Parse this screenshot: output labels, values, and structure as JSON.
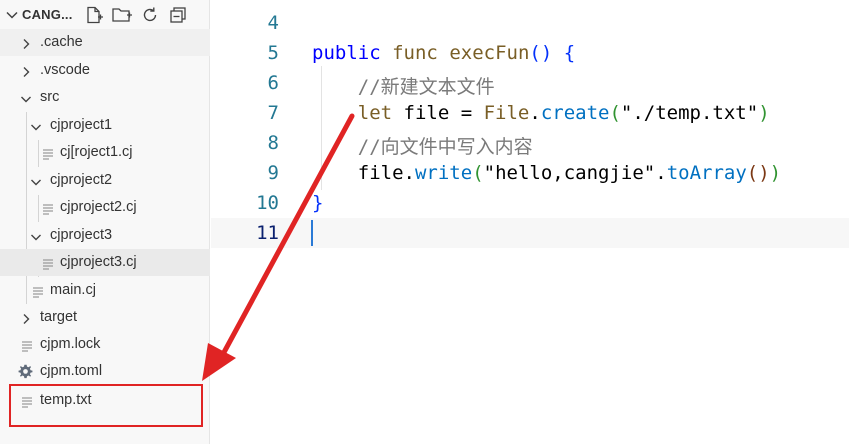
{
  "explorer": {
    "title": "CANG...",
    "actions": [
      "new-file-icon",
      "new-folder-icon",
      "refresh-icon",
      "collapse-all-icon"
    ],
    "items": [
      {
        "label": ".cache",
        "type": "folder",
        "expanded": false
      },
      {
        "label": ".vscode",
        "type": "folder",
        "expanded": false
      },
      {
        "label": "src",
        "type": "folder",
        "expanded": true
      },
      {
        "label": "cjproject1",
        "type": "folder",
        "expanded": true
      },
      {
        "label": "cj[roject1.cj",
        "type": "file"
      },
      {
        "label": "cjproject2",
        "type": "folder",
        "expanded": true
      },
      {
        "label": "cjproject2.cj",
        "type": "file"
      },
      {
        "label": "cjproject3",
        "type": "folder",
        "expanded": true
      },
      {
        "label": "cjproject3.cj",
        "type": "file",
        "selected": true
      },
      {
        "label": "main.cj",
        "type": "file"
      },
      {
        "label": "target",
        "type": "folder",
        "expanded": false
      },
      {
        "label": "cjpm.lock",
        "type": "file"
      },
      {
        "label": "cjpm.toml",
        "type": "settings-file"
      },
      {
        "label": "temp.txt",
        "type": "file",
        "highlighted": true
      }
    ]
  },
  "editor": {
    "lines": [
      {
        "number": "4",
        "tokens": []
      },
      {
        "number": "5",
        "tokens": [
          {
            "t": "public",
            "c": "kw2"
          },
          {
            "t": " "
          },
          {
            "t": "func",
            "c": "kw"
          },
          {
            "t": " "
          },
          {
            "t": "execFun",
            "c": "fn"
          },
          {
            "t": "()",
            "c": "br1"
          },
          {
            "t": " "
          },
          {
            "t": "{",
            "c": "br1"
          }
        ]
      },
      {
        "number": "6",
        "tokens": [
          {
            "t": "    "
          },
          {
            "t": "//新建文本文件",
            "c": "cmt"
          }
        ]
      },
      {
        "number": "7",
        "tokens": [
          {
            "t": "    "
          },
          {
            "t": "let",
            "c": "kw"
          },
          {
            "t": " file = "
          },
          {
            "t": "File",
            "c": "fn"
          },
          {
            "t": "."
          },
          {
            "t": "create",
            "c": "mth"
          },
          {
            "t": "(",
            "c": "br2"
          },
          {
            "t": "\"./temp.txt\"",
            "c": "plain"
          },
          {
            "t": ")",
            "c": "br2"
          }
        ]
      },
      {
        "number": "8",
        "tokens": [
          {
            "t": "    "
          },
          {
            "t": "//向文件中写入内容",
            "c": "cmt"
          }
        ]
      },
      {
        "number": "9",
        "tokens": [
          {
            "t": "    "
          },
          {
            "t": "file"
          },
          {
            "t": "."
          },
          {
            "t": "write",
            "c": "mth"
          },
          {
            "t": "(",
            "c": "br2"
          },
          {
            "t": "\"hello,cangjie\"",
            "c": "plain"
          },
          {
            "t": "."
          },
          {
            "t": "toArray",
            "c": "mth"
          },
          {
            "t": "()",
            "c": "br3"
          },
          {
            "t": ")",
            "c": "br2"
          }
        ]
      },
      {
        "number": "10",
        "tokens": [
          {
            "t": "}",
            "c": "br1"
          }
        ]
      },
      {
        "number": "11",
        "tokens": [],
        "current": true
      }
    ]
  },
  "colors": {
    "annotation_red": "#e02424",
    "cursor_blue": "#2a7ad6"
  }
}
